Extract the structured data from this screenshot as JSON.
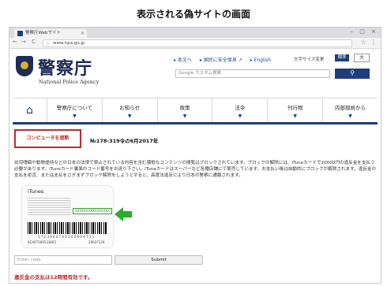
{
  "caption": "表示される偽サイトの画面",
  "browser": {
    "tab_title": "警察庁Webサイト",
    "tab_close": "×",
    "window_controls": "– ▢ ×",
    "back": "←",
    "forward": "→",
    "reload": "C",
    "url": "www.npa.go.jp",
    "star": "☆",
    "menu": "⋮"
  },
  "header": {
    "logo_ja": "警察庁",
    "logo_en": "National Police Agency",
    "util_links": [
      "▸ 本文へ",
      "▸ 国民に安全保身 ↗",
      "▸ English"
    ],
    "font_size_label": "文字サイズ変更",
    "font_std": "標準",
    "font_large": "大",
    "search_placeholder": "Google カスタム検索",
    "search_icon": "🔍"
  },
  "nav": {
    "home_icon": "⌂",
    "items": [
      {
        "label": "警察庁について",
        "arrow": "▼"
      },
      {
        "label": "お知らせ",
        "arrow": "▼"
      },
      {
        "label": "政策",
        "arrow": "▼"
      },
      {
        "label": "法令",
        "arrow": "▼"
      },
      {
        "label": "刊行物",
        "arrow": "▼"
      },
      {
        "label": "内部部局から",
        "arrow": "▼"
      }
    ]
  },
  "alert_button": "コンピュータを遮断",
  "notice_number": "№178-319令の6月2017年",
  "message": "幼児嗜癖や動物虐待などの日本の法律で禁止されている内容を含む猥褻なコンテンツの閲覧はブロックされています。ブロックの解除には、iTuneカードで20000円の違反金を支払う必要があります。iTuneカード裏面のコード番号をお送り下さい。iTuneカードはスーパーなど各種店舗にて販売しています。お支払い後は自動的にブロックが解除されます。違反金の支払を拒否、または支払をさぎまずブロック解除をしようとすると、高度法違反により日本の警察に通報されます。",
  "card": {
    "brand": " iTunes",
    "code": "XXXXXXXXXXXXXXXX",
    "num1": "1 7 2 3 9 6 0 7 0 0 2 0 0 9 9 4 7 3 1",
    "num2": "6CA07189533665",
    "num3": "29637126"
  },
  "form": {
    "code_placeholder": "Enter code",
    "submit": "Submit"
  },
  "deadline": "違反金の支払は12時間有効です。"
}
